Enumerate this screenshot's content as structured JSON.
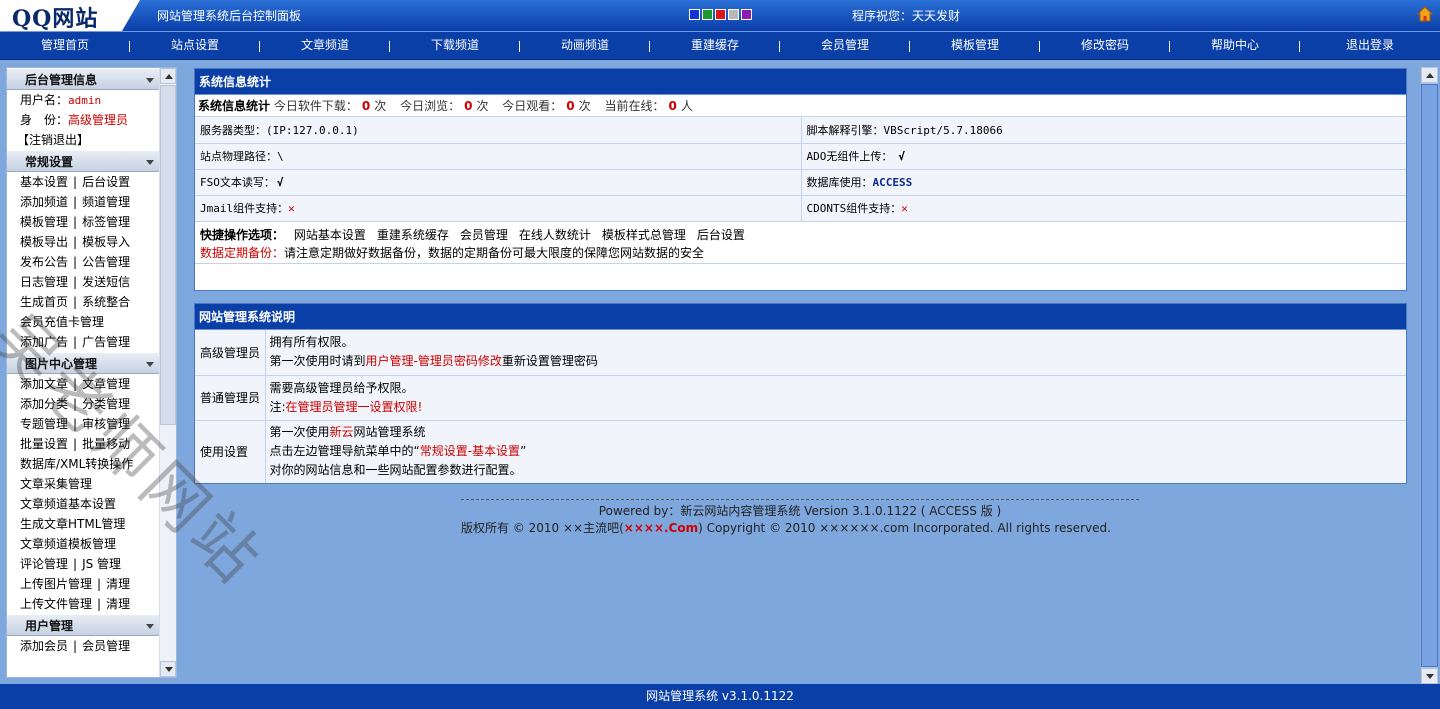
{
  "header": {
    "logo": "QQ网站",
    "title": "网站管理系统后台控制面板",
    "greeting": "程序祝您：天天发财",
    "swatch_colors": [
      "#1433d6",
      "#1a9a2c",
      "#d81818",
      "#b8b8b8",
      "#8a1ab0"
    ]
  },
  "nav": {
    "items": [
      "管理首页",
      "站点设置",
      "文章频道",
      "下载频道",
      "动画频道",
      "重建缓存",
      "会员管理",
      "模板管理",
      "修改密码",
      "帮助中心",
      "退出登录"
    ]
  },
  "sidebar": {
    "admin_info": {
      "title": "后台管理信息",
      "username_label": "用户名：",
      "username": "admin",
      "role_label": "身　份：",
      "role": "高级管理员",
      "logout": "【注销退出】"
    },
    "general": {
      "title": "常规设置",
      "rows": [
        [
          "基本设置",
          "后台设置"
        ],
        [
          "添加频道",
          "频道管理"
        ],
        [
          "模板管理",
          "标签管理"
        ],
        [
          "模板导出",
          "模板导入"
        ],
        [
          "发布公告",
          "公告管理"
        ],
        [
          "日志管理",
          "发送短信"
        ],
        [
          "生成首页",
          "系统整合"
        ],
        [
          "会员充值卡管理"
        ],
        [
          "添加广告",
          "广告管理"
        ]
      ]
    },
    "pictures": {
      "title": "图片中心管理",
      "rows": [
        [
          "添加文章",
          "文章管理"
        ],
        [
          "添加分类",
          "分类管理"
        ],
        [
          "专题管理",
          "审核管理"
        ],
        [
          "批量设置",
          "批量移动"
        ],
        [
          "数据库/XML转换操作"
        ],
        [
          "文章采集管理"
        ],
        [
          "文章频道基本设置"
        ],
        [
          "生成文章HTML管理"
        ],
        [
          "文章频道模板管理"
        ],
        [
          "评论管理",
          "JS 管理"
        ],
        [
          "上传图片管理",
          "清理"
        ],
        [
          "上传文件管理",
          "清理"
        ]
      ]
    },
    "users": {
      "title": "用户管理",
      "rows": [
        [
          "添加会员",
          "会员管理"
        ]
      ]
    },
    "separator": "|"
  },
  "stats_panel": {
    "title": "系统信息统计",
    "stats_label": "系统信息统计",
    "stats": [
      {
        "label": "今日软件下载：",
        "value": "0",
        "unit": "次"
      },
      {
        "label": "今日浏览：",
        "value": "0",
        "unit": "次"
      },
      {
        "label": "今日观看：",
        "value": "0",
        "unit": "次"
      },
      {
        "label": "当前在线：",
        "value": "0",
        "unit": "人"
      }
    ],
    "server_type": "服务器类型：(IP:127.0.0.1)",
    "script_engine": "脚本解释引擎：VBScript/5.7.18066",
    "physical_path": "站点物理路径：\\",
    "ado_upload_label": "ADO无组件上传：",
    "ado_upload_value": "√",
    "fso_label": "FSO文本读写：",
    "fso_value": "√",
    "database_label": "数据库使用：",
    "database_value": "ACCESS",
    "jmail_label": "Jmail组件支持：",
    "jmail_value": "✕",
    "cdonts_label": "CDONTS组件支持：",
    "cdonts_value": "✕",
    "quick_label": "快捷操作选项：",
    "quick_links": [
      "网站基本设置",
      "重建系统缓存",
      "会员管理",
      "在线人数统计",
      "模板样式总管理",
      "后台设置"
    ],
    "backup_label": "数据定期备份：",
    "backup_text": "请注意定期做好数据备份，数据的定期备份可最大限度的保障您网站数据的安全"
  },
  "desc_panel": {
    "title": "网站管理系统说明",
    "senior_label": "高级管理员",
    "senior_line1": "拥有所有权限。",
    "senior_line2_a": "第一次使用时请到",
    "senior_line2_link": "用户管理-管理员密码修改",
    "senior_line2_b": "重新设置管理密码",
    "normal_label": "普通管理员",
    "normal_line1": "需要高级管理员给予权限。",
    "normal_line2_a": "注:",
    "normal_line2_link": "在管理员管理一设置权限!",
    "usage_label": "使用设置",
    "usage_line1_a": "第一次使用",
    "usage_line1_link": "新云",
    "usage_line1_b": "网站管理系统",
    "usage_line2_a": "点击左边管理导航菜单中的“",
    "usage_line2_link": "常规设置-基本设置",
    "usage_line2_b": "”",
    "usage_line3": "对你的网站信息和一些网站配置参数进行配置。"
  },
  "footer": {
    "powered": "Powered by：新云网站内容管理系统 Version 3.1.0.1122 ( ACCESS 版 )",
    "copy_a": "版权所有 © 2010 ××主流吧(",
    "copy_brand": "××××.Com",
    "copy_b": ") Copyright © 2010 ××××××.com Incorporated. All rights reserved."
  },
  "statusbar": {
    "text": "网站管理系统 v3.1.0.1122"
  },
  "watermark": "吴老师网站"
}
